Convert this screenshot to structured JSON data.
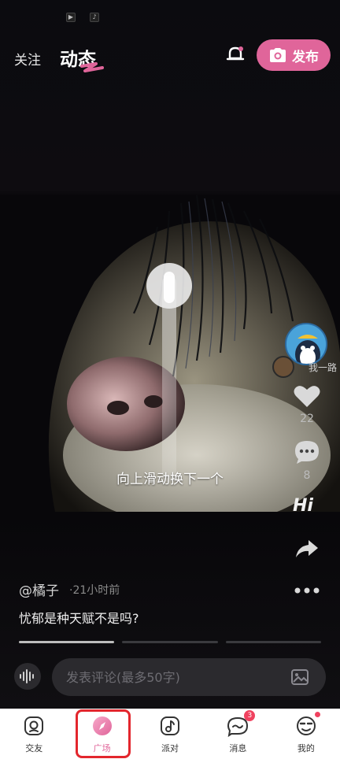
{
  "status_icons": [
    {
      "name": "media-icon",
      "glyph": "▶"
    },
    {
      "name": "tiktok-icon",
      "glyph": "♪"
    }
  ],
  "header": {
    "tab_follow": "关注",
    "tab_dynamic": "动态",
    "publish_label": "发布",
    "accent_color": "#e0659a"
  },
  "video": {
    "swipe_hint": "向上滑动换下一个"
  },
  "side_actions": {
    "username_preview": "我一路",
    "likes": "22",
    "comments": "8",
    "hi": "Hi"
  },
  "post": {
    "author": "@橘子",
    "time": "·21小时前",
    "caption": "忧郁是种天赋不是吗?"
  },
  "progress": {
    "segments": 3,
    "active_index": 0
  },
  "comment": {
    "placeholder": "发表评论(最多50字)"
  },
  "bottom_nav": {
    "items": [
      {
        "label": "交友",
        "icon": "friends-icon"
      },
      {
        "label": "广场",
        "icon": "square-compass-icon",
        "active": true
      },
      {
        "label": "派对",
        "icon": "party-music-icon"
      },
      {
        "label": "消息",
        "icon": "message-icon",
        "badge": "3"
      },
      {
        "label": "我的",
        "icon": "profile-icon",
        "dot": true
      }
    ]
  }
}
